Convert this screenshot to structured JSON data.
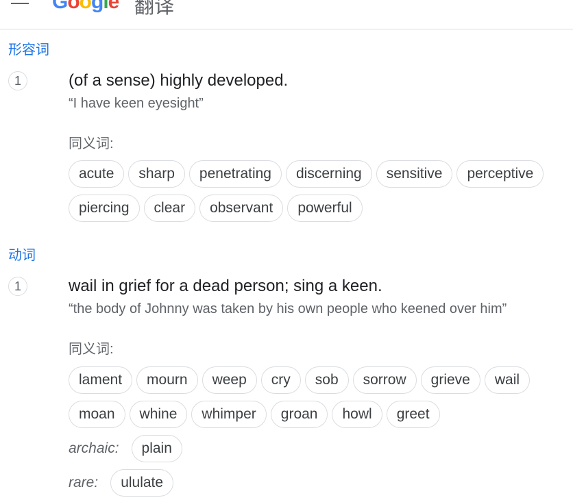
{
  "header": {
    "logo_letters": [
      "G",
      "o",
      "o",
      "g",
      "l",
      "e"
    ],
    "product_name": "翻译"
  },
  "entries": [
    {
      "part_of_speech": "形容词",
      "number": "1",
      "definition": "(of a sense) highly developed.",
      "example": "“I have keen eyesight”",
      "synonyms_label": "同义词:",
      "synonym_rows": [
        [
          "acute",
          "sharp",
          "penetrating",
          "discerning",
          "sensitive",
          "perceptive"
        ],
        [
          "piercing",
          "clear",
          "observant",
          "powerful"
        ]
      ]
    },
    {
      "part_of_speech": "动词",
      "number": "1",
      "definition": "wail in grief for a dead person; sing a keen.",
      "example": "“the body of Johnny was taken by his own people who keened over him”",
      "synonyms_label": "同义词:",
      "synonym_rows": [
        [
          "lament",
          "mourn",
          "weep",
          "cry",
          "sob",
          "sorrow",
          "grieve",
          "wail"
        ],
        [
          "moan",
          "whine",
          "whimper",
          "groan",
          "howl",
          "greet"
        ]
      ],
      "qualified": [
        {
          "label": "archaic:",
          "words": [
            "plain"
          ]
        },
        {
          "label": "rare:",
          "words": [
            "ululate"
          ]
        }
      ]
    }
  ],
  "colors": {
    "accent": "#1a73e8",
    "chip_border": "#dadce0",
    "text": "#202124",
    "muted": "#5f6368",
    "logo": [
      "#4285f4",
      "#ea4335",
      "#fbbc05",
      "#4285f4",
      "#34a853",
      "#ea4335"
    ]
  },
  "icons": {
    "menu": "hamburger-menu-icon"
  }
}
